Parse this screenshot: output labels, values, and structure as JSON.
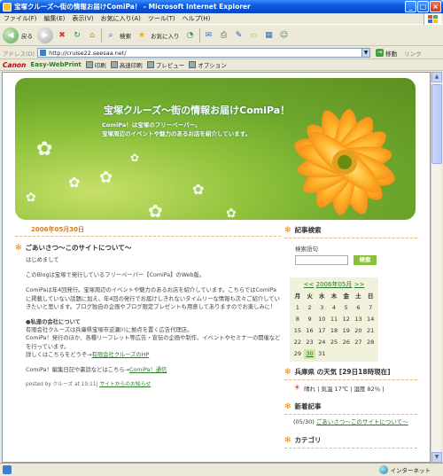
{
  "window": {
    "title": "宝塚クルーズ～街の情報お届けComiPa！ - Microsoft Internet Explorer",
    "min": "_",
    "max": "□",
    "close": "×"
  },
  "menu": [
    "ファイル(F)",
    "編集(E)",
    "表示(V)",
    "お気に入り(A)",
    "ツール(T)",
    "ヘルプ(H)"
  ],
  "toolbar": {
    "back": "戻る",
    "search": "検索",
    "favorites": "お気に入り"
  },
  "address": {
    "label": "アドレス(D)",
    "url": "http://cruise22.seesaa.net/",
    "go": "移動",
    "links": "リンク"
  },
  "canonbar": {
    "canon": "Canon",
    "ewp": "Easy-WebPrint",
    "print": "印刷",
    "fast_print": "高速印刷",
    "preview": "プレビュー",
    "options": "オプション"
  },
  "blog": {
    "title": "宝塚クルーズ～街の情報お届けComiPa！",
    "desc_line1": "ComiPa！は宝塚のフリーペーパー。",
    "desc_line2": "宝塚周辺のイベントや魅力のあるお店を紹介しています。"
  },
  "post": {
    "date": "2006年05月30日",
    "title": "ごあいさつ～このサイトについて～",
    "greeting": "はじめまして",
    "p1": "このBlogは宝塚で発行しているフリーペーパー【ComiPa】のWeb版。",
    "p2": "ComiPaは年4回発行。宝塚周辺のイベントや魅力のあるお店を紹介しています。こちらではComiPaに掲載していない話題に加え、年4回の発行でお届けしきれないタイムリーな情報も次々ご紹介していきたいと思います。ブログ独自の企画やブログ限定プレゼントも用意してありますのでお楽しみに！",
    "section_head": "●私達の会社について",
    "p3": "有限会社クルーズは兵庫県宝塚市逆瀬川に拠点を置く広告代理店。",
    "p4": "ComiPa！発行のほか、各種リーフレット等広告・宣伝の企画や制作、イベントやセミナーの開催などを行っています。",
    "p5_text": "詳しくはこちらをどうぞ→",
    "p5_link": "有限会社クルーズのHP",
    "p6_text": "ComiPa！編集日記や裏話などはこちら→",
    "p6_link": "ComiPa！通信",
    "posted_text": "posted by クルーズ  at 10:11|",
    "posted_link": "サイトからのお知らせ"
  },
  "sidebar": {
    "search_title": "記事検索",
    "search_label": "検索語句",
    "search_btn": "検索",
    "cal_prev": "<<",
    "cal_month": "2006年05月",
    "cal_next": ">>",
    "dow": [
      "月",
      "火",
      "水",
      "木",
      "金",
      "土",
      "日"
    ],
    "days": [
      "1",
      "2",
      "3",
      "4",
      "5",
      "6",
      "7",
      "8",
      "9",
      "10",
      "11",
      "12",
      "13",
      "14",
      "15",
      "16",
      "17",
      "18",
      "19",
      "20",
      "21",
      "22",
      "23",
      "24",
      "25",
      "26",
      "27",
      "28",
      "29",
      "30",
      "31"
    ],
    "weather_title": "兵庫県 の天気 [29日18時現在]",
    "weather_text": "晴れ | 気温 17℃ | 湿度 82％ |",
    "recent_title": "新着記事",
    "recent_date": "(05/30)",
    "recent_link": "ごあいさつ～このサイトについて～",
    "category_title": "カテゴリ"
  },
  "status": {
    "zone": "インターネット"
  },
  "colors": {
    "accent_green": "#8bbf3b",
    "link_green": "#2a7a2a",
    "date_orange": "#d77c20"
  }
}
